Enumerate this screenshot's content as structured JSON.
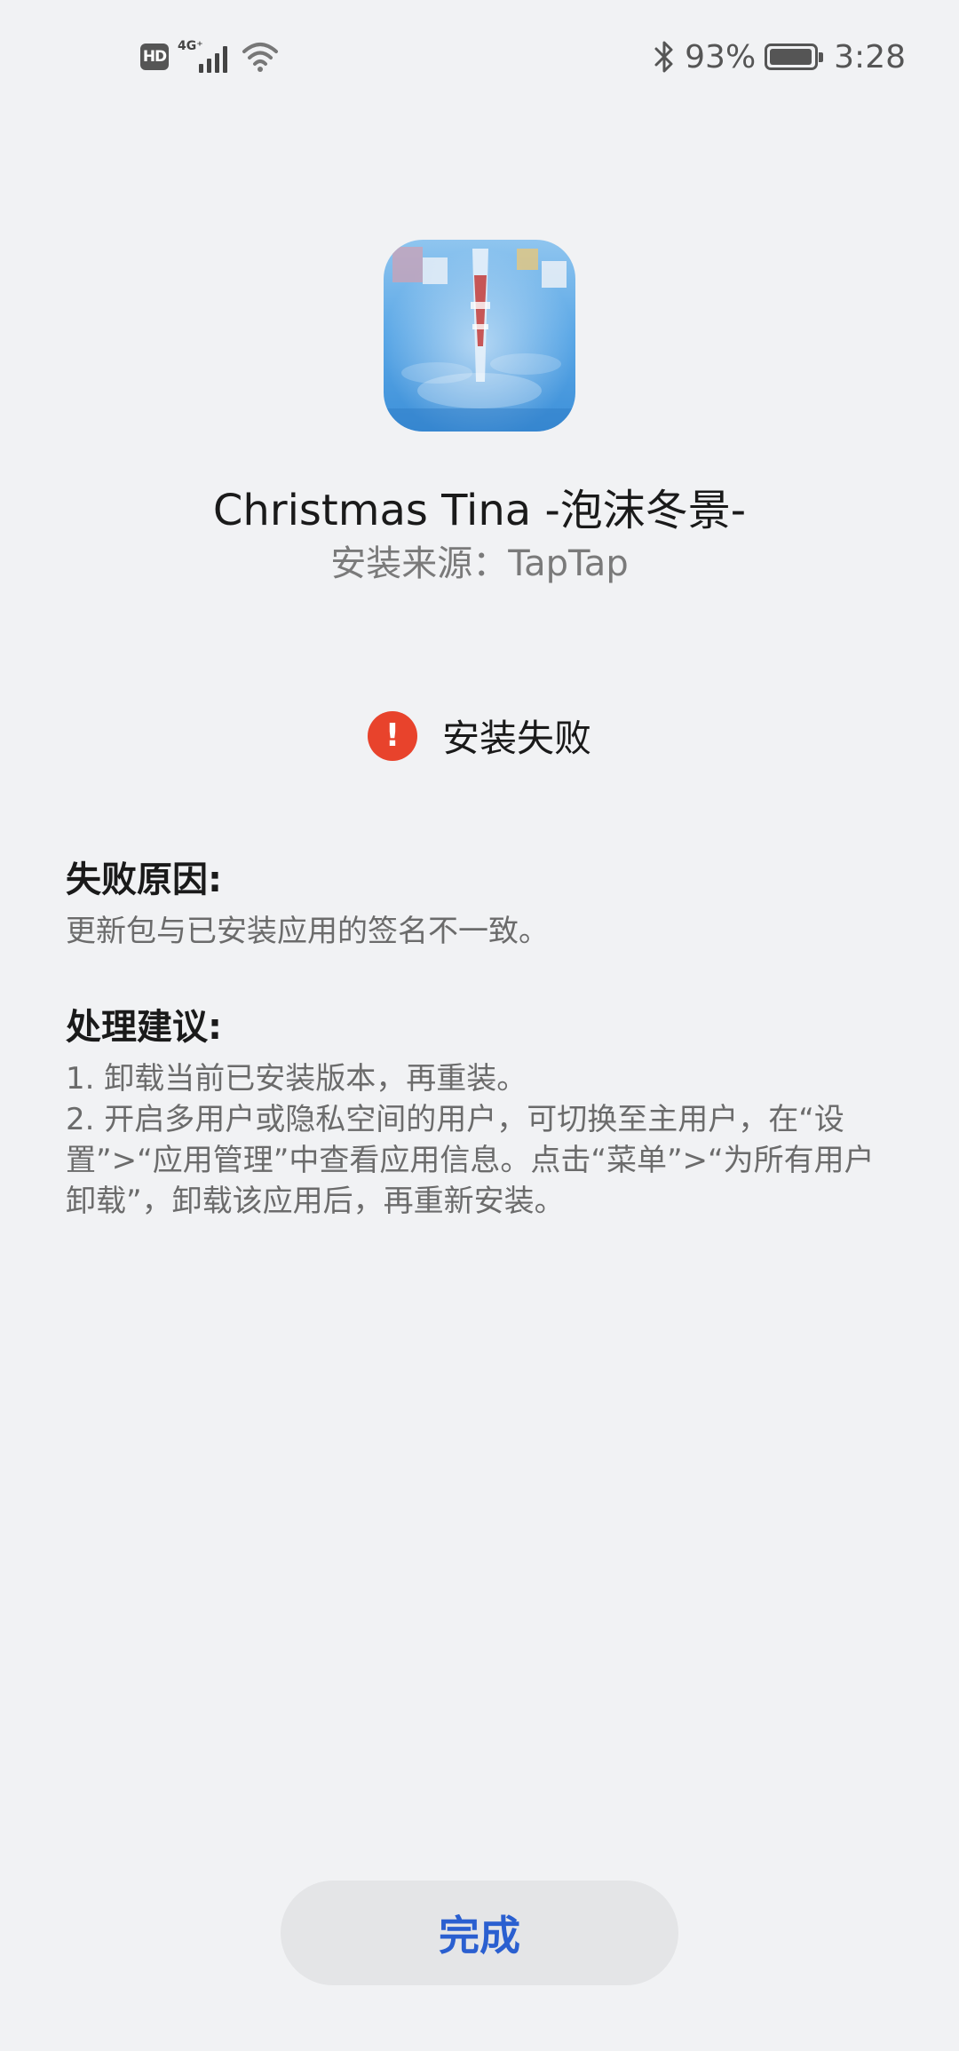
{
  "status_bar": {
    "hd": "HD",
    "network": "4G⁺",
    "battery": "93%",
    "time": "3:28",
    "icons": [
      "hd-icon",
      "signal-icon",
      "wifi-icon",
      "bluetooth-icon",
      "battery-icon"
    ]
  },
  "app": {
    "name": "Christmas Tina -泡沫冬景-",
    "source": "安装来源：TapTap",
    "icon": "app-icon"
  },
  "status": {
    "icon": "error-icon",
    "icon_glyph": "!",
    "text": "安装失败",
    "color": "#e8432c"
  },
  "reason": {
    "title": "失败原因:",
    "body": "更新包与已安装应用的签名不一致。"
  },
  "advice": {
    "title": "处理建议:",
    "items": [
      "1. 卸载当前已安装版本，再重装。",
      "2. 开启多用户或隐私空间的用户，可切换至主用户，在“设置”>“应用管理”中查看应用信息。点击“菜单”>“为所有用户卸载”，卸载该应用后，再重新安装。"
    ]
  },
  "actions": {
    "done": "完成",
    "done_color": "#2a5fd0"
  }
}
